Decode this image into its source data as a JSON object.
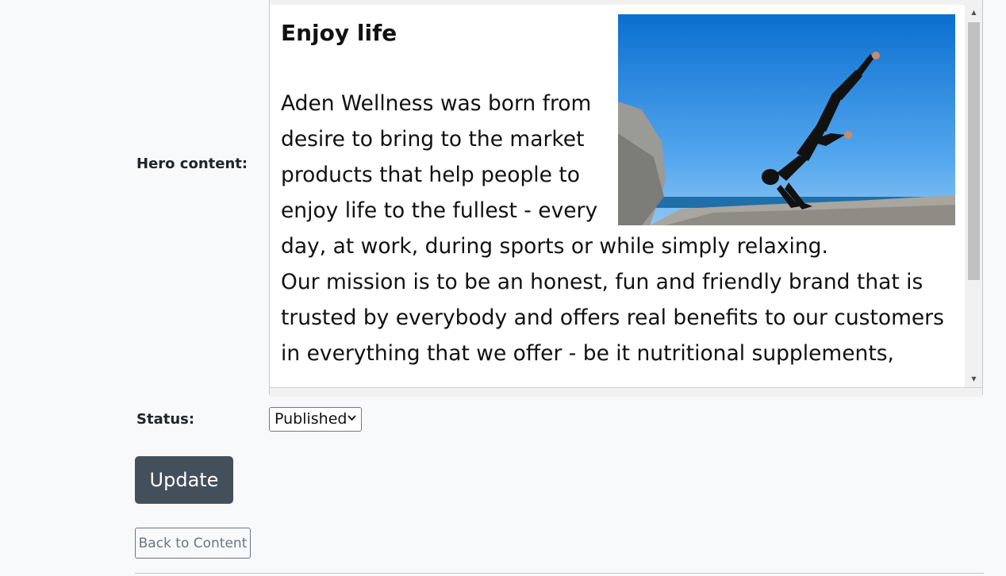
{
  "form": {
    "hero_label": "Hero content:",
    "status_label": "Status:",
    "status_value": "Published",
    "update_label": "Update",
    "back_label": "Back to Content"
  },
  "editor": {
    "heading": "Enjoy life",
    "paragraph1": "Aden Wellness was born from desire to bring to the market products that help people to enjoy life to the fullest - every day, at work, during sports or while simply relaxing.",
    "paragraph2": "Our mission is to be an honest, fun and friendly brand that is trusted by everybody and offers real benefits to our customers in everything that we offer - be it nutritional supplements,",
    "image": "yoga-pose-on-rocks-by-sea"
  },
  "colors": {
    "update_button_bg": "#444f5c",
    "page_bg": "#f8f9fa"
  }
}
